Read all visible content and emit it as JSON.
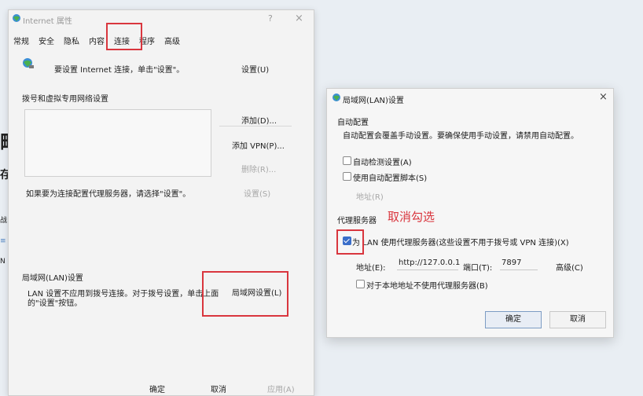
{
  "background": {
    "fragments": [
      "略",
      "存",
      "战",
      "≡",
      "N"
    ]
  },
  "internet_properties": {
    "title": "Internet 属性",
    "help": "?",
    "close": "×",
    "tabs": [
      "常规",
      "安全",
      "隐私",
      "内容",
      "连接",
      "程序",
      "高级"
    ],
    "setup_text": "要设置 Internet 连接，单击\"设置\"。",
    "setup_button": "设置(U)",
    "dialup_section": "拨号和虚拟专用网络设置",
    "add_button": "添加(D)...",
    "add_vpn_button": "添加 VPN(P)...",
    "remove_button": "删除(R)...",
    "proxy_note": "如果要为连接配置代理服务器，请选择\"设置\"。",
    "settings_button": "设置(S)",
    "lan_section": "局域网(LAN)设置",
    "lan_desc_line1": "LAN 设置不应用到拨号连接。对于拨号设置，单击上面",
    "lan_desc_line2": "的\"设置\"按钮。",
    "lan_settings_button": "局域网设置(L)",
    "ok": "确定",
    "cancel": "取消",
    "apply": "应用(A)"
  },
  "lan_dialog": {
    "title": "局域网(LAN)设置",
    "close": "×",
    "auto_config_title": "自动配置",
    "auto_config_desc": "自动配置会覆盖手动设置。要确保使用手动设置，请禁用自动配置。",
    "auto_detect": "自动检测设置(A)",
    "use_script": "使用自动配置脚本(S)",
    "address_disabled": "地址(R)",
    "proxy_title": "代理服务器",
    "annotation": "取消勾选",
    "use_proxy": "为 LAN 使用代理服务器(这些设置不用于拨号或 VPN 连接)(X)",
    "address_label": "地址(E):",
    "address_value": "http://127.0.0.1",
    "port_label": "端口(T):",
    "port_value": "7897",
    "advanced": "高级(C)",
    "bypass_local": "对于本地地址不使用代理服务器(B)",
    "ok": "确定",
    "cancel": "取消"
  },
  "colors": {
    "annotation_red": "#d9363e",
    "checkbox_blue": "#3a6ec9"
  },
  "icons": {
    "window_icon": "globe-icon",
    "setup_icon": "globe-network-icon"
  }
}
